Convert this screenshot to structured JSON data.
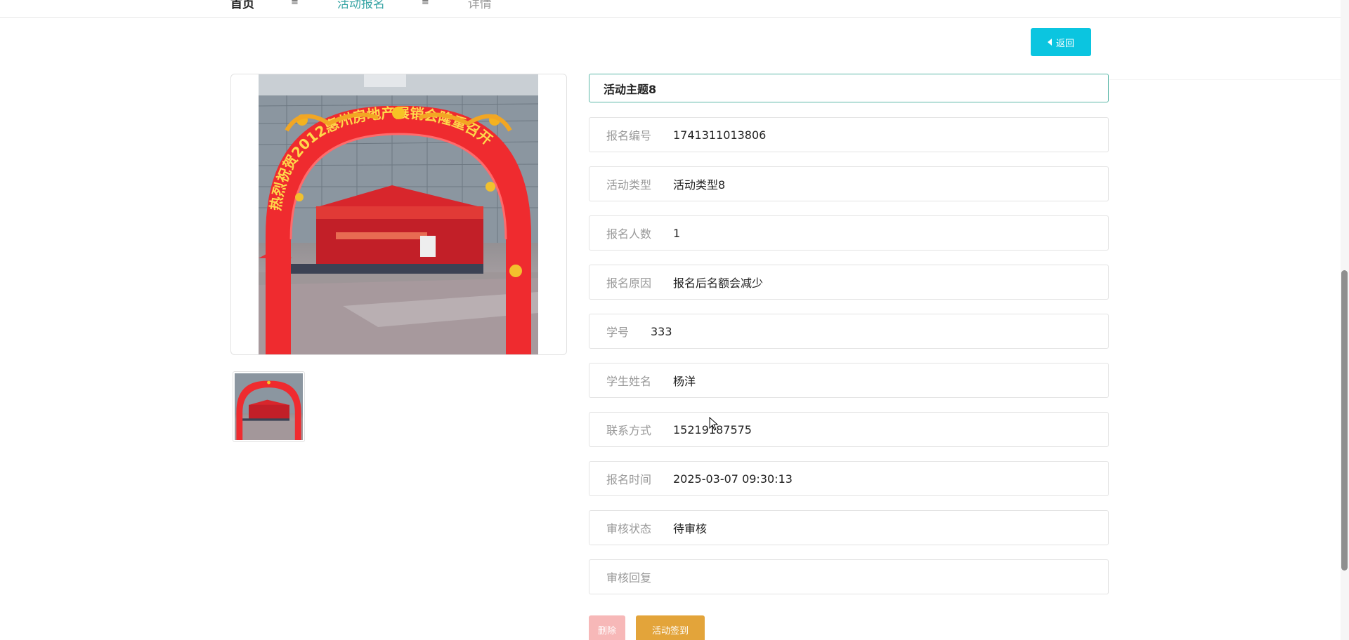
{
  "breadcrumb": {
    "home": "首页",
    "separator": "≡",
    "section": "活动报名",
    "current": "详情"
  },
  "back_button": {
    "label": "返回",
    "icon": "caret-left-icon"
  },
  "title": "活动主题8",
  "fields": [
    {
      "name": "registration-number",
      "label": "报名编号",
      "value": "1741311013806"
    },
    {
      "name": "activity-type",
      "label": "活动类型",
      "value": "活动类型8"
    },
    {
      "name": "participants-count",
      "label": "报名人数",
      "value": "1"
    },
    {
      "name": "registration-reason",
      "label": "报名原因",
      "value": "报名后名额会减少"
    },
    {
      "name": "student-id",
      "label": "学号",
      "value": "333"
    },
    {
      "name": "student-name",
      "label": "学生姓名",
      "value": "杨洋"
    },
    {
      "name": "contact",
      "label": "联系方式",
      "value": "15219187575"
    },
    {
      "name": "registration-time",
      "label": "报名时间",
      "value": "2025-03-07 09:30:13"
    },
    {
      "name": "review-status",
      "label": "审核状态",
      "value": "待审核"
    },
    {
      "name": "review-reply",
      "label": "审核回复",
      "value": ""
    }
  ],
  "actions": {
    "delete": "删除",
    "sign_in": "活动签到"
  },
  "photo_banner_text": "热烈祝贺2012惠州房地产展销会隆重召开",
  "colors": {
    "accent": "#3aa6a6",
    "back_button": "#0bc5e0",
    "delete_button": "#f7b8b8",
    "signin_button": "#e3a43a",
    "title_border": "#5cb8a8"
  }
}
